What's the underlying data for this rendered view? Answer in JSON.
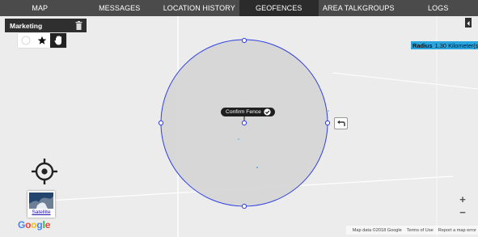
{
  "tabs": [
    {
      "label": "MAP",
      "active": false
    },
    {
      "label": "MESSAGES",
      "active": false
    },
    {
      "label": "LOCATION HISTORY",
      "active": false
    },
    {
      "label": "GEOFENCES",
      "active": true
    },
    {
      "label": "AREA TALKGROUPS",
      "active": false
    },
    {
      "label": "LOGS",
      "active": false
    }
  ],
  "group": {
    "name": "Marketing",
    "delete_icon": "trash-icon"
  },
  "tools": [
    "circle-icon",
    "star-icon",
    "hand-icon"
  ],
  "radius": {
    "label": "Radius",
    "value": "1.30 Kilometer(s)"
  },
  "fence": {
    "confirm_label": "Confirm Fence",
    "fill": "#d5d5d5",
    "stroke": "#2f3fe0"
  },
  "map": {
    "satellite_label": "Satellite",
    "zoom_in": "+",
    "zoom_out": "−",
    "logo": "Google",
    "attribution": {
      "map_data": "Map data ©2018 Google",
      "terms": "Terms of Use",
      "report": "Report a map error"
    }
  },
  "colors": {
    "tabbar": "#4b4b4b",
    "active_tab": "#2b2b2b",
    "radius_bg": "#29a6e0"
  }
}
